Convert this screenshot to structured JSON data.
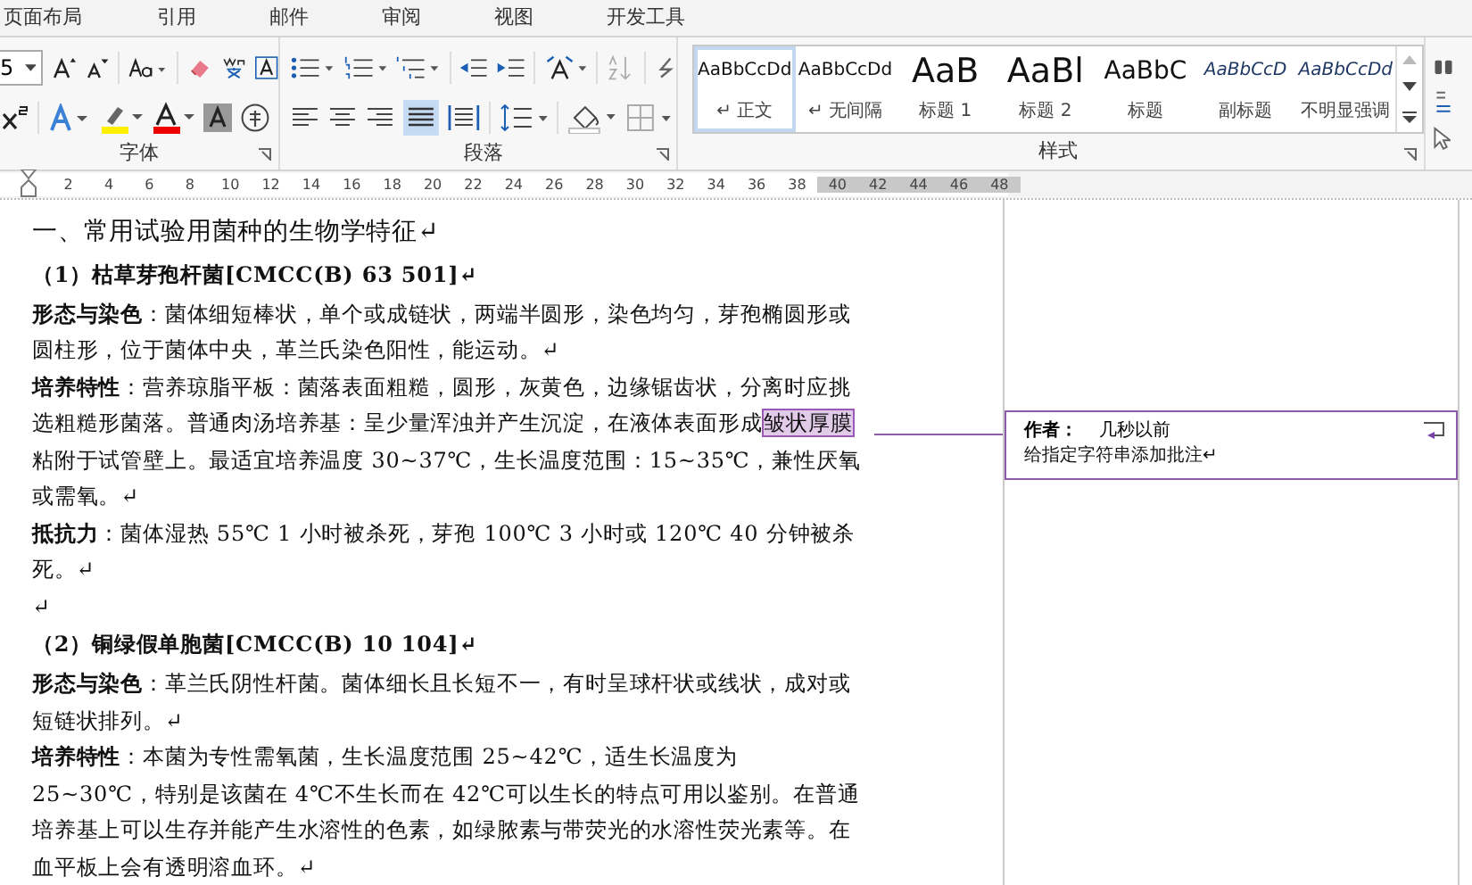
{
  "menu_tabs": [
    "页面布局",
    "引用",
    "邮件",
    "审阅",
    "视图",
    "开发工具"
  ],
  "ribbon": {
    "font_size": "5",
    "groups": [
      "字体",
      "段落",
      "样式"
    ],
    "styles": [
      {
        "preview": "AaBbCcDd",
        "name": "↵ 正文",
        "kind": "normal",
        "selected": true
      },
      {
        "preview": "AaBbCcDd",
        "name": "↵ 无间隔",
        "kind": "normal",
        "selected": false
      },
      {
        "preview": "AaB",
        "name": "标题 1",
        "kind": "heading",
        "selected": false
      },
      {
        "preview": "AaBl",
        "name": "标题 2",
        "kind": "heading",
        "selected": false
      },
      {
        "preview": "AaBbC",
        "name": "标题",
        "kind": "title",
        "selected": false
      },
      {
        "preview": "AaBbCcD",
        "name": "副标题",
        "kind": "italic",
        "selected": false
      },
      {
        "preview": "AaBbCcDd",
        "name": "不明显强调",
        "kind": "italic",
        "selected": false
      }
    ]
  },
  "ruler": {
    "numbers": [
      "2",
      "4",
      "6",
      "8",
      "10",
      "12",
      "14",
      "16",
      "18",
      "20",
      "22",
      "24",
      "26",
      "28",
      "30",
      "32",
      "34",
      "36",
      "38",
      "40",
      "42",
      "44",
      "46",
      "48"
    ]
  },
  "document": [
    {
      "kind": "heading",
      "text": "一、常用试验用菌种的生物学特征↵"
    },
    {
      "kind": "subheading",
      "text": "（1）枯草芽孢杆菌[CMCC(B) 63 501]↵"
    },
    {
      "kind": "paragraph",
      "text": "**形态与染色**：菌体细短棒状，单个或成链状，两端半圆形，染色均匀，芽孢椭圆形或圆柱形，位于菌体中央，革兰氏染色阳性，能运动。↵"
    },
    {
      "kind": "annotated",
      "text_before": "**培养特性**：营养琼脂平板：菌落表面粗糙，圆形，灰黄色，边缘锯齿状，分离时应挑选粗糙形菌落。普通肉汤培养基：呈少量浑浊并产生沉淀，在液体表面形成",
      "highlight": "皱状厚膜",
      "text_after": "粘附于试管壁上。最适宜培养温度 30~37℃，生长温度范围：15~35℃，兼性厌氧或需氧。↵"
    },
    {
      "kind": "paragraph",
      "text": "**抵抗力**：菌体湿热 55℃ 1 小时被杀死，芽孢 100℃ 3 小时或 120℃ 40 分钟被杀死。↵"
    },
    {
      "kind": "empty",
      "text": "↵"
    },
    {
      "kind": "subheading",
      "text": "（2）铜绿假单胞菌[CMCC(B) 10 104]↵"
    },
    {
      "kind": "paragraph",
      "text": "**形态与染色**：革兰氏阴性杆菌。菌体细长且长短不一，有时呈球杆状或线状，成对或短链状排列。↵"
    },
    {
      "kind": "paragraph",
      "text": "**培养特性**：本菌为专性需氧菌，生长温度范围 25~42℃，适生长温度为 25~30℃，特别是该菌在 4℃不生长而在 42℃可以生长的特点可用以鉴别。在普通培养基上可以生存并能产生水溶性的色素，如绿脓素与带荧光的水溶性荧光素等。在血平板上会有透明溶血环。↵"
    }
  ],
  "comment": {
    "author_label": "作者：",
    "time": "几秒以前",
    "text": "给指定字符串添加批注↵"
  }
}
